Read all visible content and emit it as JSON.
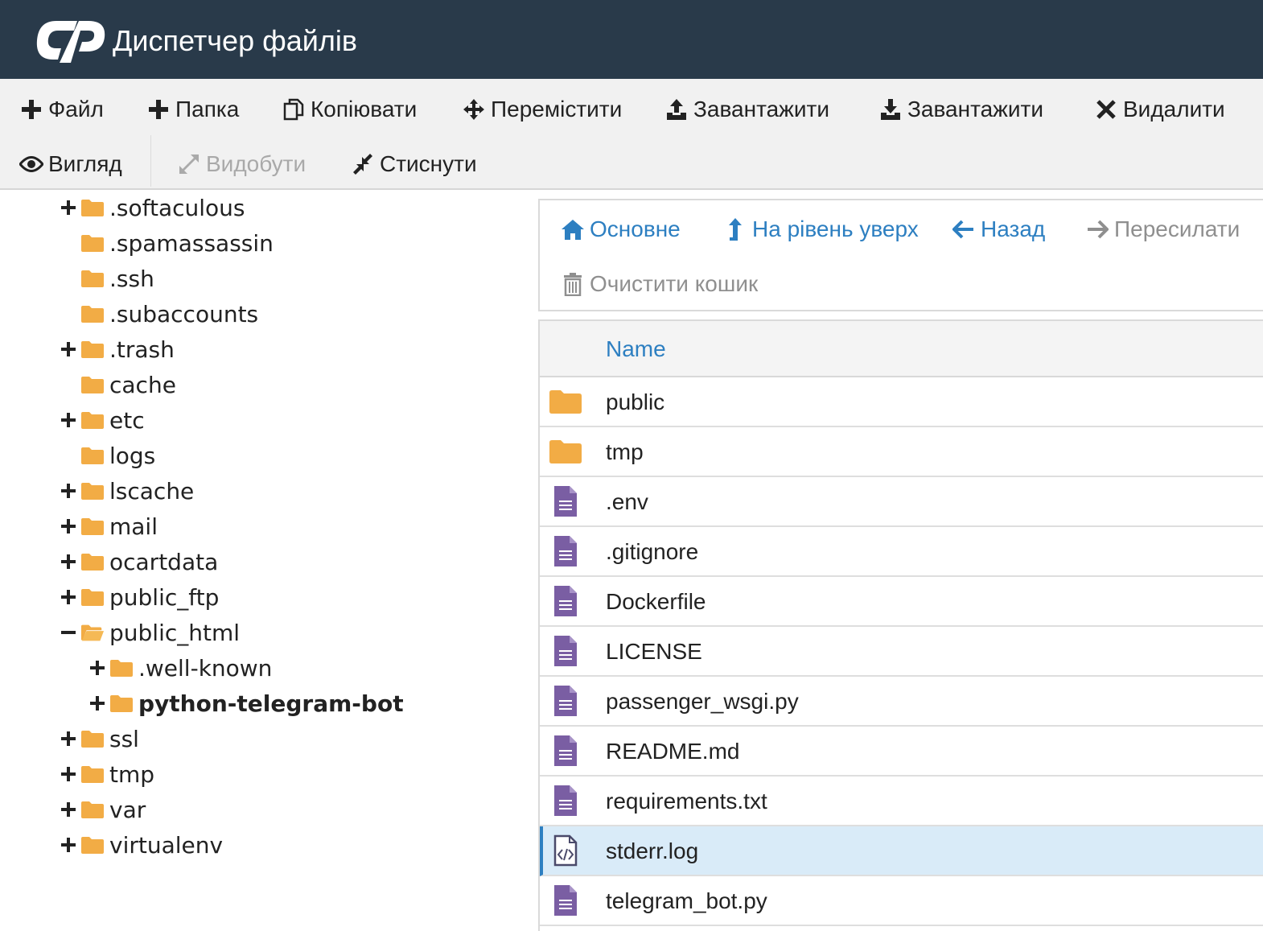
{
  "app": {
    "title": "Диспетчер файлів"
  },
  "toolbar": {
    "row1": [
      {
        "label": "Файл",
        "icon": "plus-icon"
      },
      {
        "label": "Папка",
        "icon": "plus-icon"
      },
      {
        "label": "Копіювати",
        "icon": "copy-icon"
      },
      {
        "label": "Перемістити",
        "icon": "move-icon"
      },
      {
        "label": "Завантажити",
        "icon": "upload-icon"
      },
      {
        "label": "Завантажити",
        "icon": "download-icon"
      },
      {
        "label": "Видалити",
        "icon": "x-icon"
      }
    ],
    "row2": [
      {
        "label": "Вигляд",
        "icon": "eye-icon"
      },
      {
        "label": "Видобути",
        "icon": "expand-icon",
        "disabled": true
      },
      {
        "label": "Стиснути",
        "icon": "compress-icon"
      }
    ]
  },
  "tree": [
    {
      "label": ".softaculous",
      "expander": "+",
      "level": 0
    },
    {
      "label": ".spamassassin",
      "expander": "",
      "level": 0
    },
    {
      "label": ".ssh",
      "expander": "",
      "level": 0
    },
    {
      "label": ".subaccounts",
      "expander": "",
      "level": 0
    },
    {
      "label": ".trash",
      "expander": "+",
      "level": 0
    },
    {
      "label": "cache",
      "expander": "",
      "level": 0
    },
    {
      "label": "etc",
      "expander": "+",
      "level": 0
    },
    {
      "label": "logs",
      "expander": "",
      "level": 0
    },
    {
      "label": "lscache",
      "expander": "+",
      "level": 0
    },
    {
      "label": "mail",
      "expander": "+",
      "level": 0
    },
    {
      "label": "ocartdata",
      "expander": "+",
      "level": 0
    },
    {
      "label": "public_ftp",
      "expander": "+",
      "level": 0
    },
    {
      "label": "public_html",
      "expander": "−",
      "level": 0,
      "open": true
    },
    {
      "label": ".well-known",
      "expander": "+",
      "level": 1
    },
    {
      "label": "python-telegram-bot",
      "expander": "+",
      "level": 1,
      "bold": true
    },
    {
      "label": "ssl",
      "expander": "+",
      "level": 0
    },
    {
      "label": "tmp",
      "expander": "+",
      "level": 0
    },
    {
      "label": "var",
      "expander": "+",
      "level": 0
    },
    {
      "label": "virtualenv",
      "expander": "+",
      "level": 0
    }
  ],
  "nav": {
    "home": "Основне",
    "up": "На рівень уверх",
    "back": "Назад",
    "forward": "Пересилати",
    "empty_trash": "Очистити кошик"
  },
  "table": {
    "header_name": "Name",
    "rows": [
      {
        "name": "public",
        "type": "folder"
      },
      {
        "name": "tmp",
        "type": "folder"
      },
      {
        "name": ".env",
        "type": "text"
      },
      {
        "name": ".gitignore",
        "type": "text"
      },
      {
        "name": "Dockerfile",
        "type": "text"
      },
      {
        "name": "LICENSE",
        "type": "text"
      },
      {
        "name": "passenger_wsgi.py",
        "type": "text"
      },
      {
        "name": "README.md",
        "type": "text"
      },
      {
        "name": "requirements.txt",
        "type": "text"
      },
      {
        "name": "stderr.log",
        "type": "code",
        "selected": true
      },
      {
        "name": "telegram_bot.py",
        "type": "text"
      }
    ]
  },
  "colors": {
    "header_bg": "#293a4a",
    "link_blue": "#2d7fc1",
    "folder_orange": "#f2ac45",
    "file_purple": "#7a5ea3",
    "selected_row": "#d9ebf8"
  }
}
